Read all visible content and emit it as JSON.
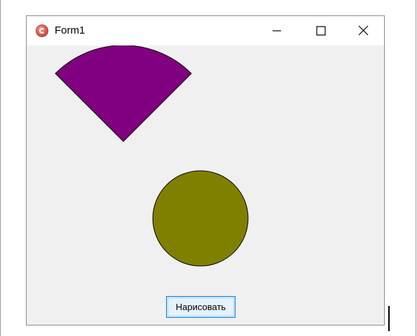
{
  "window": {
    "title": "Form1",
    "icon": "app-icon",
    "controls": {
      "minimize_icon": "minimize-icon",
      "maximize_icon": "maximize-icon",
      "close_icon": "close-icon"
    }
  },
  "canvas": {
    "background_color": "#f0f0f0",
    "shapes": [
      {
        "type": "pie-sector",
        "fill": "#800080",
        "stroke": "#000000"
      },
      {
        "type": "circle",
        "fill": "#808000",
        "stroke": "#000000"
      }
    ]
  },
  "button": {
    "label": "Нарисовать"
  }
}
